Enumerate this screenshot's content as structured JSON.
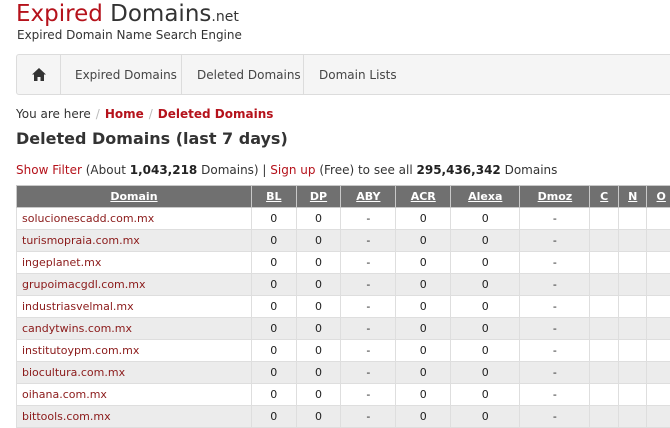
{
  "logo": {
    "part1": "Expired",
    "part2": " Domains",
    "part3": ".net"
  },
  "tagline": "Expired Domain Name Search Engine",
  "nav": {
    "home_icon": "home-icon",
    "items": [
      "Expired Domains",
      "Deleted Domains",
      "Domain Lists"
    ]
  },
  "breadcrumb": {
    "prefix": "You are here",
    "sep": "/",
    "home": "Home",
    "current": "Deleted Domains"
  },
  "page_title": "Deleted Domains (last 7 days)",
  "info": {
    "show_filter": "Show Filter",
    "about_prefix": " (About ",
    "count": "1,043,218",
    "count_suffix": " Domains) | ",
    "sign_up": "Sign up",
    "free_text": " (Free) to see all ",
    "total": "295,436,342",
    "total_suffix": " Domains"
  },
  "table": {
    "columns": [
      "Domain",
      "BL",
      "DP",
      "ABY",
      "ACR",
      "Alexa",
      "Dmoz",
      "C",
      "N",
      "O"
    ],
    "rows": [
      [
        "solucionescadd.com.mx",
        "0",
        "0",
        "-",
        "0",
        "0",
        "-",
        "",
        "",
        ""
      ],
      [
        "turismopraia.com.mx",
        "0",
        "0",
        "-",
        "0",
        "0",
        "-",
        "",
        "",
        ""
      ],
      [
        "ingeplanet.mx",
        "0",
        "0",
        "-",
        "0",
        "0",
        "-",
        "",
        "",
        ""
      ],
      [
        "grupoimacgdl.com.mx",
        "0",
        "0",
        "-",
        "0",
        "0",
        "-",
        "",
        "",
        ""
      ],
      [
        "industriasvelmal.mx",
        "0",
        "0",
        "-",
        "0",
        "0",
        "-",
        "",
        "",
        ""
      ],
      [
        "candytwins.com.mx",
        "0",
        "0",
        "-",
        "0",
        "0",
        "-",
        "",
        "",
        ""
      ],
      [
        "institutoypm.com.mx",
        "0",
        "0",
        "-",
        "0",
        "0",
        "-",
        "",
        "",
        ""
      ],
      [
        "biocultura.com.mx",
        "0",
        "0",
        "-",
        "0",
        "0",
        "-",
        "",
        "",
        ""
      ],
      [
        "oihana.com.mx",
        "0",
        "0",
        "-",
        "0",
        "0",
        "-",
        "",
        "",
        ""
      ],
      [
        "bittools.com.mx",
        "0",
        "0",
        "-",
        "0",
        "0",
        "-",
        "",
        "",
        ""
      ]
    ]
  },
  "colors": {
    "brand": "#b5121b",
    "header_bg": "#707070",
    "alt_row": "#ececec"
  }
}
